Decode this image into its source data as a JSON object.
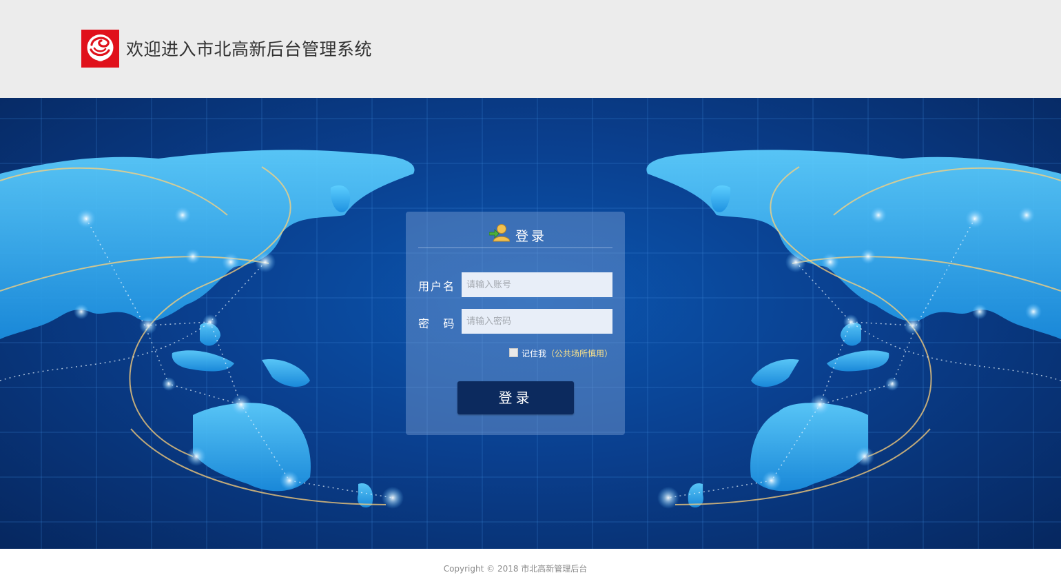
{
  "header": {
    "title": "欢迎进入市北高新后台管理系统",
    "logo_icon": "rose-logo-icon"
  },
  "login": {
    "title": "登录",
    "title_icon": "user-login-icon",
    "username_label": "用户名",
    "username_placeholder": "请输入账号",
    "username_value": "",
    "password_label": "密    码",
    "password_placeholder": "请输入密码",
    "password_value": "",
    "remember_label": "记住我",
    "remember_note": "（公共场所慎用）",
    "remember_checked": false,
    "submit_label": "登录"
  },
  "footer": {
    "copyright": "Copyright © 2018 市北高新管理后台"
  },
  "colors": {
    "header_bg": "#ececec",
    "logo_red": "#e0111b",
    "button_bg": "#0c2a5e",
    "banner_blue": "#0a3f8e",
    "note_yellow": "#ffe58a"
  }
}
